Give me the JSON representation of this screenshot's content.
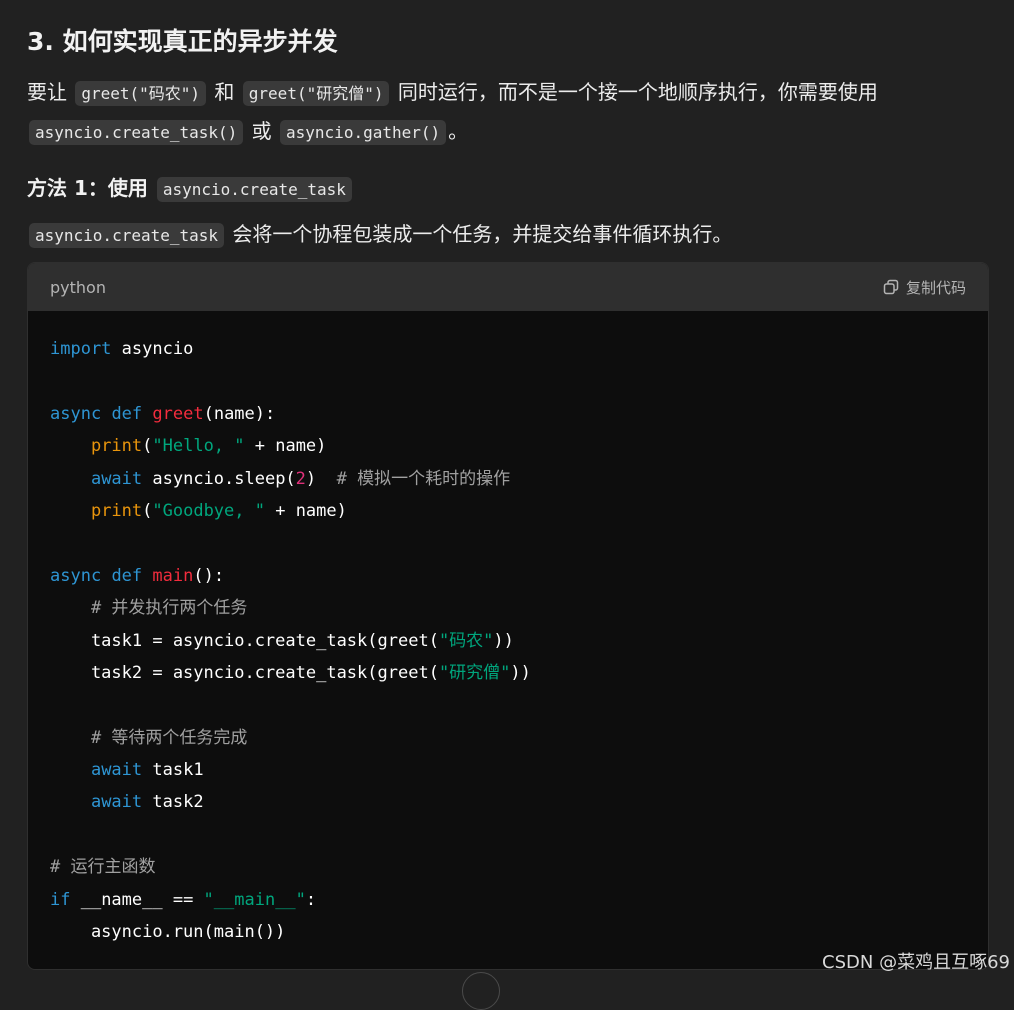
{
  "heading": "3. 如何实现真正的异步并发",
  "para1": {
    "text1": "要让",
    "code1": "greet(\"码农\")",
    "text2": "和",
    "code2": "greet(\"研究僧\")",
    "text3": "同时运行，而不是一个接一个地顺序执行，你需要使用",
    "code3": "asyncio.create_task()",
    "text4": "或",
    "code4": "asyncio.gather()",
    "text5": "。"
  },
  "method1": {
    "title": "方法 1：使用",
    "code": "asyncio.create_task"
  },
  "para2": {
    "code": "asyncio.create_task",
    "text": "会将一个协程包装成一个任务，并提交给事件循环执行。"
  },
  "codeblock": {
    "language": "python",
    "copy_label": "复制代码",
    "lines": [
      [
        {
          "t": "import",
          "c": "kw"
        },
        {
          "t": " asyncio",
          "c": ""
        }
      ],
      [],
      [
        {
          "t": "async",
          "c": "kw"
        },
        {
          "t": " ",
          "c": ""
        },
        {
          "t": "def",
          "c": "kw"
        },
        {
          "t": " ",
          "c": ""
        },
        {
          "t": "greet",
          "c": "fn"
        },
        {
          "t": "(name):",
          "c": ""
        }
      ],
      [
        {
          "t": "    ",
          "c": ""
        },
        {
          "t": "print",
          "c": "bi"
        },
        {
          "t": "(",
          "c": ""
        },
        {
          "t": "\"Hello, \"",
          "c": "str"
        },
        {
          "t": " + name)",
          "c": ""
        }
      ],
      [
        {
          "t": "    ",
          "c": ""
        },
        {
          "t": "await",
          "c": "kw"
        },
        {
          "t": " asyncio.sleep(",
          "c": ""
        },
        {
          "t": "2",
          "c": "num"
        },
        {
          "t": ")  ",
          "c": ""
        },
        {
          "t": "# 模拟一个耗时的操作",
          "c": "cm"
        }
      ],
      [
        {
          "t": "    ",
          "c": ""
        },
        {
          "t": "print",
          "c": "bi"
        },
        {
          "t": "(",
          "c": ""
        },
        {
          "t": "\"Goodbye, \"",
          "c": "str"
        },
        {
          "t": " + name)",
          "c": ""
        }
      ],
      [],
      [
        {
          "t": "async",
          "c": "kw"
        },
        {
          "t": " ",
          "c": ""
        },
        {
          "t": "def",
          "c": "kw"
        },
        {
          "t": " ",
          "c": ""
        },
        {
          "t": "main",
          "c": "fn"
        },
        {
          "t": "():",
          "c": ""
        }
      ],
      [
        {
          "t": "    ",
          "c": ""
        },
        {
          "t": "# 并发执行两个任务",
          "c": "cm"
        }
      ],
      [
        {
          "t": "    task1 = asyncio.create_task(greet(",
          "c": ""
        },
        {
          "t": "\"码农\"",
          "c": "str"
        },
        {
          "t": "))",
          "c": ""
        }
      ],
      [
        {
          "t": "    task2 = asyncio.create_task(greet(",
          "c": ""
        },
        {
          "t": "\"研究僧\"",
          "c": "str"
        },
        {
          "t": "))",
          "c": ""
        }
      ],
      [],
      [
        {
          "t": "    ",
          "c": ""
        },
        {
          "t": "# 等待两个任务完成",
          "c": "cm"
        }
      ],
      [
        {
          "t": "    ",
          "c": ""
        },
        {
          "t": "await",
          "c": "kw"
        },
        {
          "t": " task1",
          "c": ""
        }
      ],
      [
        {
          "t": "    ",
          "c": ""
        },
        {
          "t": "await",
          "c": "kw"
        },
        {
          "t": " task2",
          "c": ""
        }
      ],
      [],
      [
        {
          "t": "# 运行主函数",
          "c": "cm"
        }
      ],
      [
        {
          "t": "if",
          "c": "kw"
        },
        {
          "t": " __name__ == ",
          "c": ""
        },
        {
          "t": "\"__main__\"",
          "c": "str"
        },
        {
          "t": ":",
          "c": ""
        }
      ],
      [
        {
          "t": "    asyncio.run(main())",
          "c": ""
        }
      ]
    ]
  },
  "watermark": "CSDN @菜鸡且互啄69",
  "colors": {
    "background": "#212121",
    "code_background": "#0d0d0d",
    "keyword": "#2e95d3",
    "function": "#f22c3d",
    "builtin": "#e9950c",
    "string": "#00a67d",
    "number": "#df3079",
    "comment": "#a0a0a0"
  }
}
